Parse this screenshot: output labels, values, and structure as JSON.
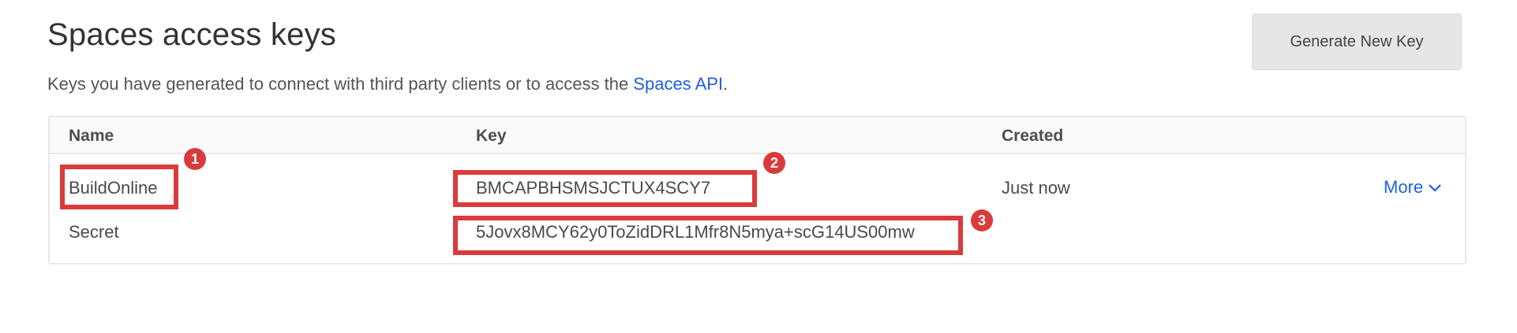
{
  "header": {
    "title": "Spaces access keys",
    "subtitle_prefix": "Keys you have generated to connect with third party clients or to access the ",
    "subtitle_link": "Spaces API",
    "subtitle_suffix": ".",
    "generate_button": "Generate New Key"
  },
  "table": {
    "columns": [
      "Name",
      "Key",
      "Created"
    ],
    "row": {
      "name": "BuildOnline",
      "key": "BMCAPBHSMSJCTUX4SCY7",
      "created": "Just now",
      "more_label": "More",
      "secret_label": "Secret",
      "secret_value": "5Jovx8MCY62y0ToZidDRL1Mfr8N5mya+scG14US00mw"
    }
  },
  "annotations": [
    "1",
    "2",
    "3"
  ],
  "colors": {
    "link": "#1f5fe0",
    "annotation": "#d93b3b"
  }
}
